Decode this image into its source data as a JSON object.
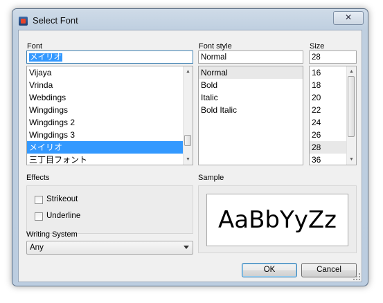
{
  "window": {
    "title": "Select Font",
    "close_symbol": "✕"
  },
  "font": {
    "label": "Font",
    "value": "メイリオ",
    "items": [
      "Vijaya",
      "Vrinda",
      "Webdings",
      "Wingdings",
      "Wingdings 2",
      "Wingdings 3",
      "メイリオ",
      "三丁目フォント"
    ],
    "selected_index": 6
  },
  "style": {
    "label": "Font style",
    "value": "Normal",
    "items": [
      "Normal",
      "Bold",
      "Italic",
      "Bold Italic"
    ],
    "current_index": 0
  },
  "size": {
    "label": "Size",
    "value": "28",
    "items": [
      "16",
      "18",
      "20",
      "22",
      "24",
      "26",
      "28",
      "36"
    ],
    "current_index": 6
  },
  "effects": {
    "label": "Effects",
    "strikeout": "Strikeout",
    "underline": "Underline"
  },
  "writing_system": {
    "label": "Writing System",
    "value": "Any"
  },
  "sample": {
    "label": "Sample",
    "text": "AaBbYyZz"
  },
  "buttons": {
    "ok": "OK",
    "cancel": "Cancel"
  },
  "colors": {
    "selection": "#3399ff",
    "dialog_bg": "#f0f0f0",
    "frame": "#bccde0"
  }
}
